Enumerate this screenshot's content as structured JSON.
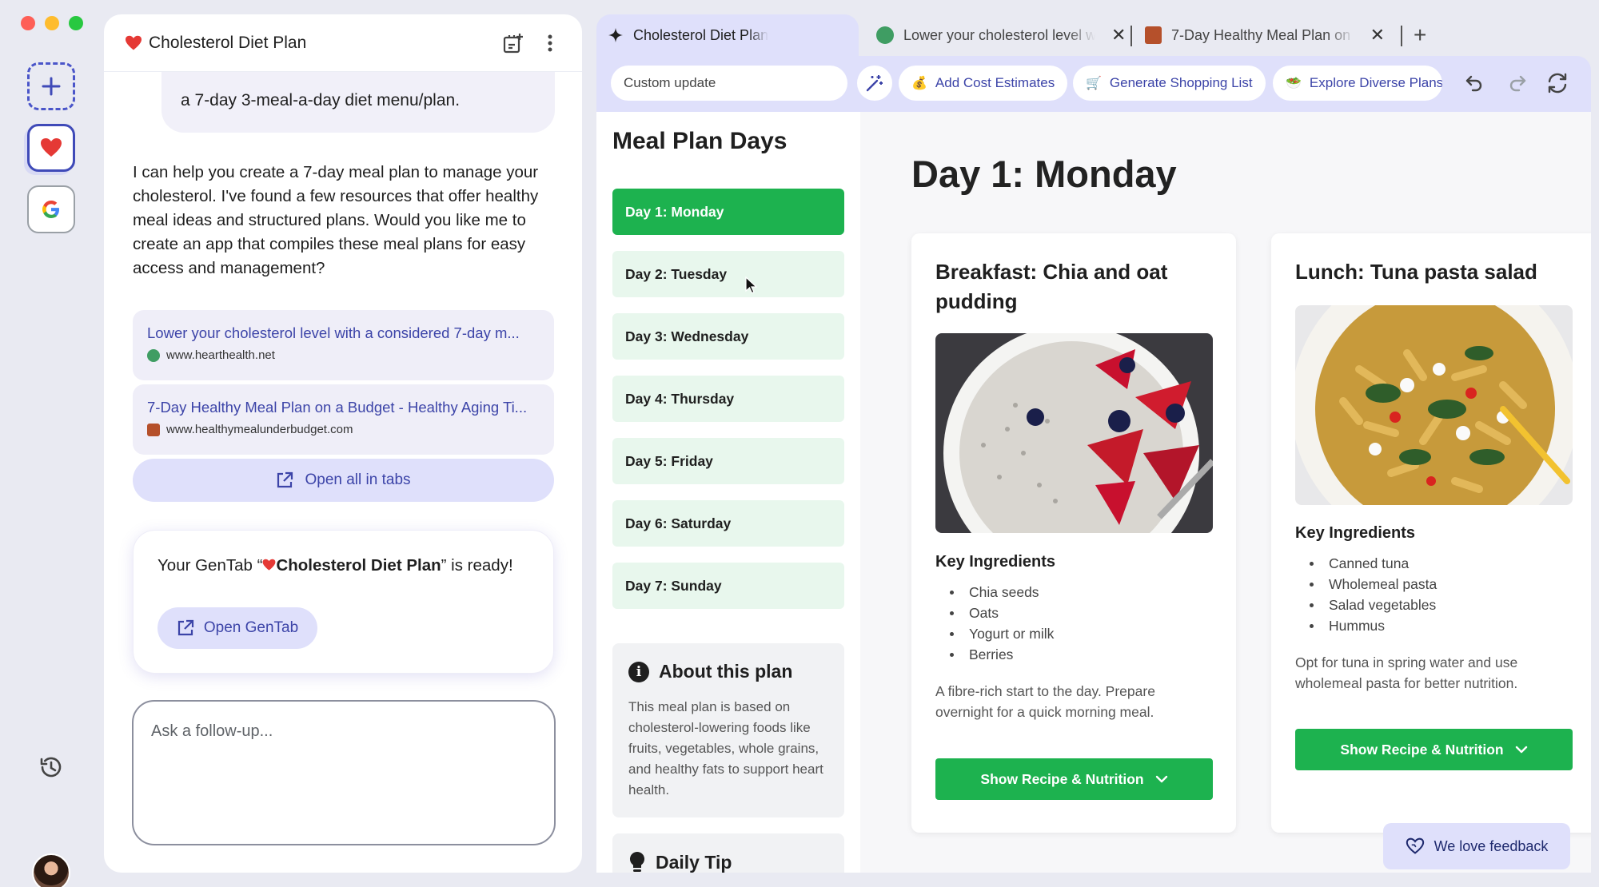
{
  "colors": {
    "accent": "#3c44a8",
    "green": "#1db24f",
    "panel": "#dfe0fb"
  },
  "chat": {
    "title": "Cholesterol Diet Plan",
    "user_message": "a 7-day 3-meal-a-day diet menu/plan.",
    "reply": "I can help you create a 7-day meal plan to manage your cholesterol. I've found a few resources that offer healthy meal ideas and structured plans. Would you like me to create an app that compiles these meal plans for easy access and management?",
    "sources": [
      {
        "title": "Lower your cholesterol level with a considered 7-day m...",
        "url": "www.hearthealth.net"
      },
      {
        "title": "7-Day Healthy Meal Plan on a Budget - Healthy Aging Ti...",
        "url": "www.healthymealunderbudget.com"
      }
    ],
    "open_all_label": "Open all in tabs",
    "gentab_prefix": "Your GenTab “",
    "gentab_name": "Cholesterol Diet Plan",
    "gentab_suffix": "” is ready!",
    "open_gentab_label": "Open GenTab",
    "followup_placeholder": "Ask a follow-up..."
  },
  "tabs": [
    {
      "label": "Cholesterol Diet Plan"
    },
    {
      "label": "Lower your cholesterol level w"
    },
    {
      "label": "7-Day Healthy Meal Plan on a"
    }
  ],
  "toolbar": {
    "custom_update_placeholder": "Custom update",
    "chips": [
      "Add Cost Estimates",
      "Generate Shopping List",
      "Explore Diverse Plans"
    ]
  },
  "sidebar": {
    "title": "Meal Plan Days",
    "days": [
      "Day 1: Monday",
      "Day 2: Tuesday",
      "Day 3: Wednesday",
      "Day 4: Thursday",
      "Day 5: Friday",
      "Day 6: Saturday",
      "Day 7: Sunday"
    ],
    "about_title": "About this plan",
    "about_text": "This meal plan is based on cholesterol-lowering foods like fruits, vegetables, whole grains, and healthy fats to support heart health.",
    "tip_title": "Daily Tip"
  },
  "main": {
    "day_title": "Day 1: Monday",
    "meals": [
      {
        "title": "Breakfast: Chia and oat pudding",
        "ingredients_heading": "Key Ingredients",
        "ingredients": [
          "Chia seeds",
          "Oats",
          "Yogurt or milk",
          "Berries"
        ],
        "description": "A fibre-rich start to the day. Prepare overnight for a quick morning meal.",
        "button": "Show Recipe & Nutrition"
      },
      {
        "title": "Lunch: Tuna pasta salad",
        "ingredients_heading": "Key Ingredients",
        "ingredients": [
          "Canned tuna",
          "Wholemeal pasta",
          "Salad vegetables",
          "Hummus"
        ],
        "description": "Opt for tuna in spring water and use wholemeal pasta for better nutrition.",
        "button": "Show Recipe & Nutrition"
      }
    ],
    "feedback_label": "We love feedback"
  }
}
